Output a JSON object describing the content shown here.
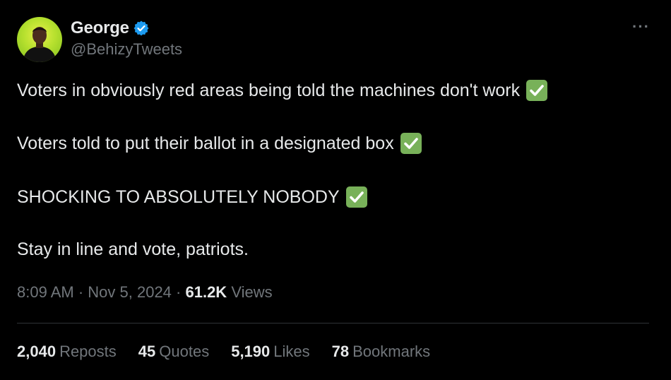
{
  "author": {
    "display_name": "George",
    "handle": "@BehizyTweets",
    "verified_icon": "verified-badge-icon",
    "avatar_icon": "avatar"
  },
  "more_menu": {
    "label": "···",
    "icon": "more-icon"
  },
  "tweet": {
    "lines": [
      "Voters in obviously red areas being told the machines don't work",
      "Voters told to put their ballot in a designated box",
      "SHOCKING TO ABSOLUTELY NOBODY",
      "Stay in line and vote, patriots."
    ],
    "check_icon": "check-mark-icon"
  },
  "meta": {
    "time": "8:09 AM",
    "sep1": " · ",
    "date": "Nov 5, 2024",
    "sep2": " · ",
    "views_count": "61.2K",
    "views_label": "Views"
  },
  "stats": [
    {
      "count": "2,040",
      "label": "Reposts"
    },
    {
      "count": "45",
      "label": "Quotes"
    },
    {
      "count": "5,190",
      "label": "Likes"
    },
    {
      "count": "78",
      "label": "Bookmarks"
    }
  ],
  "colors": {
    "background": "#000000",
    "text_primary": "#e7e9ea",
    "text_secondary": "#71767b",
    "verified_blue": "#1d9bf0",
    "check_green": "#78b159",
    "divider": "#2f3336"
  }
}
